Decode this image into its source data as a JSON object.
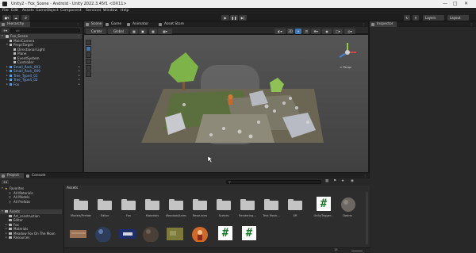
{
  "window": {
    "title": "Unity2 - Fox_Scene - Android - Unity 2022.3.45f1 <DX11>"
  },
  "menu": [
    "File",
    "Edit",
    "Assets",
    "GameObject",
    "Component",
    "Services",
    "Window",
    "Help"
  ],
  "toolbar": {
    "layers": "Layers",
    "layout": "Layout"
  },
  "hierarchy": {
    "tab": "Hierarchy",
    "search_placeholder": "All",
    "items": [
      {
        "label": "Fox_Scene",
        "depth": 0,
        "style": "scene",
        "selected": "dark",
        "expanded": true
      },
      {
        "label": "MainCamera",
        "depth": 1,
        "style": "normal"
      },
      {
        "label": "PrepsTarget",
        "depth": 1,
        "style": "normal",
        "expanded": true
      },
      {
        "label": "Directional Light",
        "depth": 2,
        "style": "normal"
      },
      {
        "label": "Plane",
        "depth": 2,
        "style": "normal"
      },
      {
        "label": "EventSystem",
        "depth": 2,
        "style": "normal"
      },
      {
        "label": "Controller",
        "depth": 2,
        "style": "normal"
      },
      {
        "label": "Small_Rock_003",
        "depth": 1,
        "style": "prefab",
        "collapsed": true
      },
      {
        "label": "Small_Rock_009",
        "depth": 1,
        "style": "prefab",
        "collapsed": true
      },
      {
        "label": "Tree_Type4_01",
        "depth": 1,
        "style": "prefab",
        "collapsed": true
      },
      {
        "label": "Tree_Type4_02",
        "depth": 1,
        "style": "prefab",
        "collapsed": true
      },
      {
        "label": "Fox",
        "depth": 1,
        "style": "prefab",
        "collapsed": true
      }
    ]
  },
  "scene": {
    "tabs": [
      "Scene",
      "Game",
      "Animator",
      "Asset Store"
    ],
    "shading": "Center",
    "pivot": "Global",
    "gizmo_label": "< Persp"
  },
  "inspector": {
    "tab": "Inspector"
  },
  "project": {
    "tabs": [
      "Project",
      "Console"
    ],
    "favorites_label": "Favorites",
    "favorites": [
      "All Materials",
      "All Models",
      "All Prefabs"
    ],
    "assets_label": "Assets",
    "asset_tree": [
      "Art_construction",
      "Editor",
      "Fox",
      "Materials",
      "Meadow Fox On The Moon",
      "Resources"
    ],
    "breadcrumb": "Assets",
    "search_placeholder": "",
    "assets_row1": [
      "Models/Prefabs",
      "Editor",
      "Fox",
      "Materials",
      "Meadow/Animation",
      "Resources",
      "Scenes",
      "Rendering...",
      "Text Mesh...",
      "XR",
      "UnityTrigger...",
      "Debris"
    ],
    "assets_row2_kinds": [
      "wood-material",
      "sphere-material",
      "flag-texture",
      "sphere-material-dark",
      "ground-texture",
      "character-icon",
      "script",
      "script"
    ],
    "footer_count": "18"
  },
  "colors": {
    "accent": "#2c5d87",
    "prefab_text": "#7ab1f2",
    "background": "#282828"
  }
}
